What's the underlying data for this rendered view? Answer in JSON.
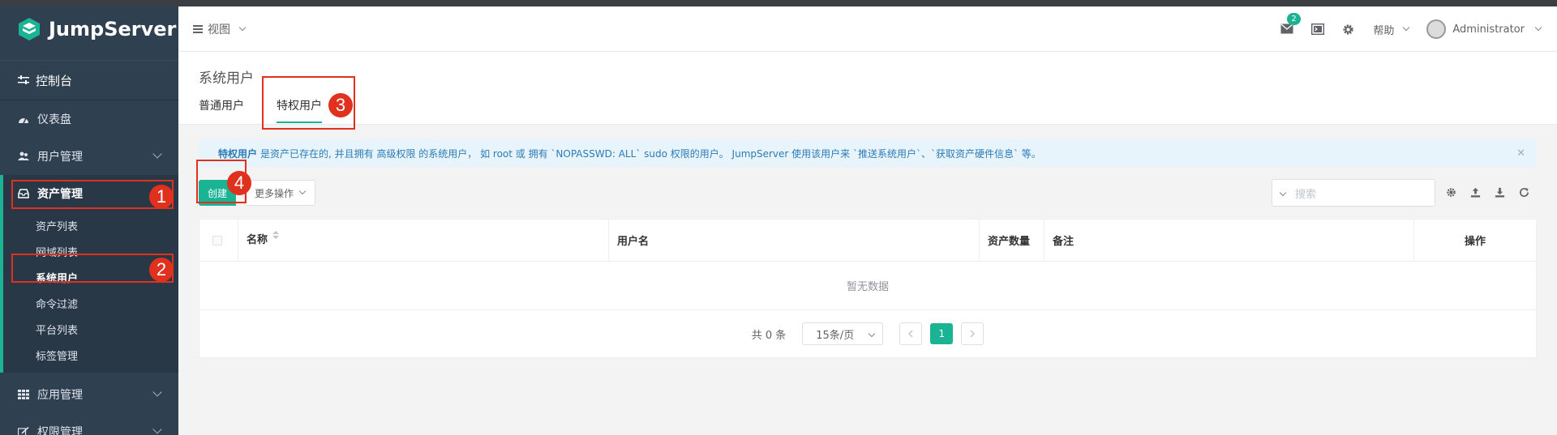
{
  "app": {
    "brand": "JumpServer"
  },
  "sidebar": {
    "console_label": "控制台",
    "items": [
      {
        "label": "仪表盘",
        "icon": "dashboard-icon"
      },
      {
        "label": "用户管理",
        "icon": "users-icon"
      }
    ],
    "asset_group": {
      "label": "资产管理",
      "sub_items": [
        "资产列表",
        "网域列表",
        "系统用户",
        "命令过滤",
        "平台列表",
        "标签管理"
      ]
    },
    "bottom_items": [
      {
        "label": "应用管理",
        "icon": "grid-icon"
      },
      {
        "label": "权限管理",
        "icon": "edit-icon"
      }
    ]
  },
  "header": {
    "view_label": "视图",
    "badge_count": "2",
    "help_label": "帮助",
    "user_name": "Administrator"
  },
  "page": {
    "title": "系统用户",
    "tabs": [
      "普通用户",
      "特权用户"
    ],
    "active_tab": 1
  },
  "alert": {
    "strong": "特权用户",
    "text": "是资产已存在的, 并且拥有 高级权限 的系统用户， 如 root 或 拥有 `NOPASSWD: ALL` sudo 权限的用户。 JumpServer 使用该用户来 `推送系统用户`、`获取资产硬件信息` 等。"
  },
  "toolbar": {
    "create_label": "创建",
    "more_label": "更多操作",
    "search_placeholder": "搜索"
  },
  "table": {
    "columns": [
      "名称",
      "用户名",
      "资产数量",
      "备注",
      "操作"
    ],
    "empty_text": "暂无数据"
  },
  "pagination": {
    "total_text": "共 0 条",
    "page_size": "15条/页",
    "current_page": "1"
  },
  "annotations": [
    "1",
    "2",
    "3",
    "4"
  ],
  "colors": {
    "accent": "#1ab394",
    "sidebar": "#2f4050",
    "marker": "#e0301e"
  }
}
